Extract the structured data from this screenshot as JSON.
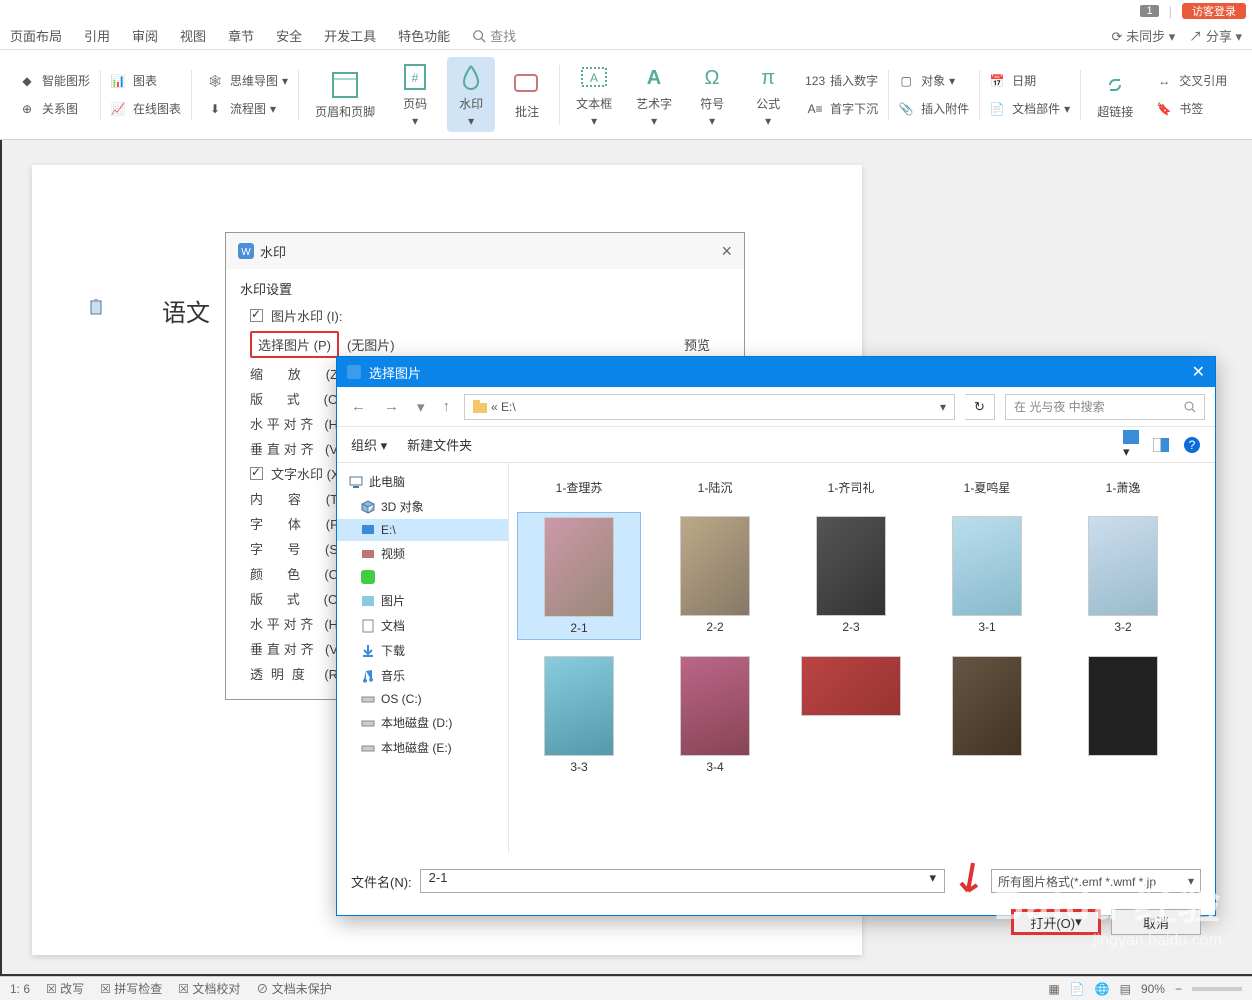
{
  "titlebar": {
    "badge": "1",
    "login": "访客登录"
  },
  "menubar": {
    "tabs": [
      "页面布局",
      "引用",
      "审阅",
      "视图",
      "章节",
      "安全",
      "开发工具",
      "特色功能"
    ],
    "search": "查找",
    "sync": "未同步",
    "share": "分享"
  },
  "ribbon": {
    "group1": {
      "smart_shape": "智能图形",
      "chart": "图表",
      "relation": "关系图",
      "online_chart": "在线图表"
    },
    "group2": {
      "mindmap": "思维导图",
      "flowchart": "流程图"
    },
    "header_footer": "页眉和页脚",
    "page_num": "页码",
    "watermark": "水印",
    "comment": "批注",
    "textbox": "文本框",
    "wordart": "艺术字",
    "symbol": "符号",
    "formula": "公式",
    "group3": {
      "insert_num": "插入数字",
      "drop_cap": "首字下沉",
      "object": "对象",
      "attachment": "插入附件",
      "date": "日期",
      "doc_parts": "文档部件"
    },
    "hyperlink": "超链接",
    "group4": {
      "cross_ref": "交叉引用",
      "bookmark": "书签"
    }
  },
  "document": {
    "text": "语文"
  },
  "wm_dialog": {
    "title": "水印",
    "section": "水印设置",
    "pic_wm": "图片水印 (I):",
    "select_pic": "选择图片 (P)",
    "no_pic": "(无图片)",
    "zoom": "缩   放 (Z):",
    "layout1": "版   式 (O):",
    "halign1": "水平对齐 (H):",
    "valign1": "垂直对齐 (V):",
    "text_wm": "文字水印 (X)",
    "content": "内   容 (T):",
    "font": "字   体 (F):",
    "size": "字   号 (S):",
    "color": "颜   色 (C):",
    "layout2": "版   式 (O):",
    "halign2": "水平对齐 (H):",
    "valign2": "垂直对齐 (V):",
    "opacity": "透明度 (R):",
    "preview": "预览"
  },
  "file_picker": {
    "title": "选择图片",
    "path_prefix": "« E:\\",
    "search_placeholder": "在 光与夜 中搜索",
    "organize": "组织",
    "new_folder": "新建文件夹",
    "tree": {
      "this_pc": "此电脑",
      "obj3d": "3D 对象",
      "e_drive": "E:\\",
      "video": "视频",
      "pictures": "图片",
      "documents": "文档",
      "downloads": "下载",
      "music": "音乐",
      "os_c": "OS (C:)",
      "local_d": "本地磁盘 (D:)",
      "local_e": "本地磁盘 (E:)"
    },
    "files_row0": [
      "1-查理苏",
      "1-陆沉",
      "1-齐司礼",
      "1-夏鸣星",
      "1-萧逸"
    ],
    "files_row1": [
      "2-1",
      "2-2",
      "2-3",
      "3-1",
      "3-2"
    ],
    "files_row2": [
      "3-3",
      "3-4"
    ],
    "filename_label": "文件名(N):",
    "filename_value": "2-1",
    "filter": "所有图片格式(*.emf *.wmf *.jp",
    "open": "打开(O)",
    "cancel": "取消"
  },
  "statusbar": {
    "page": "1: 6",
    "revise": "改写",
    "spellcheck": "拼写检查",
    "proofread": "文档校对",
    "unprotect": "文档未保护",
    "zoom": "90%"
  },
  "baidu_wm": {
    "logo": "Baidu 经验",
    "url": "jingyan.baidu.com"
  }
}
